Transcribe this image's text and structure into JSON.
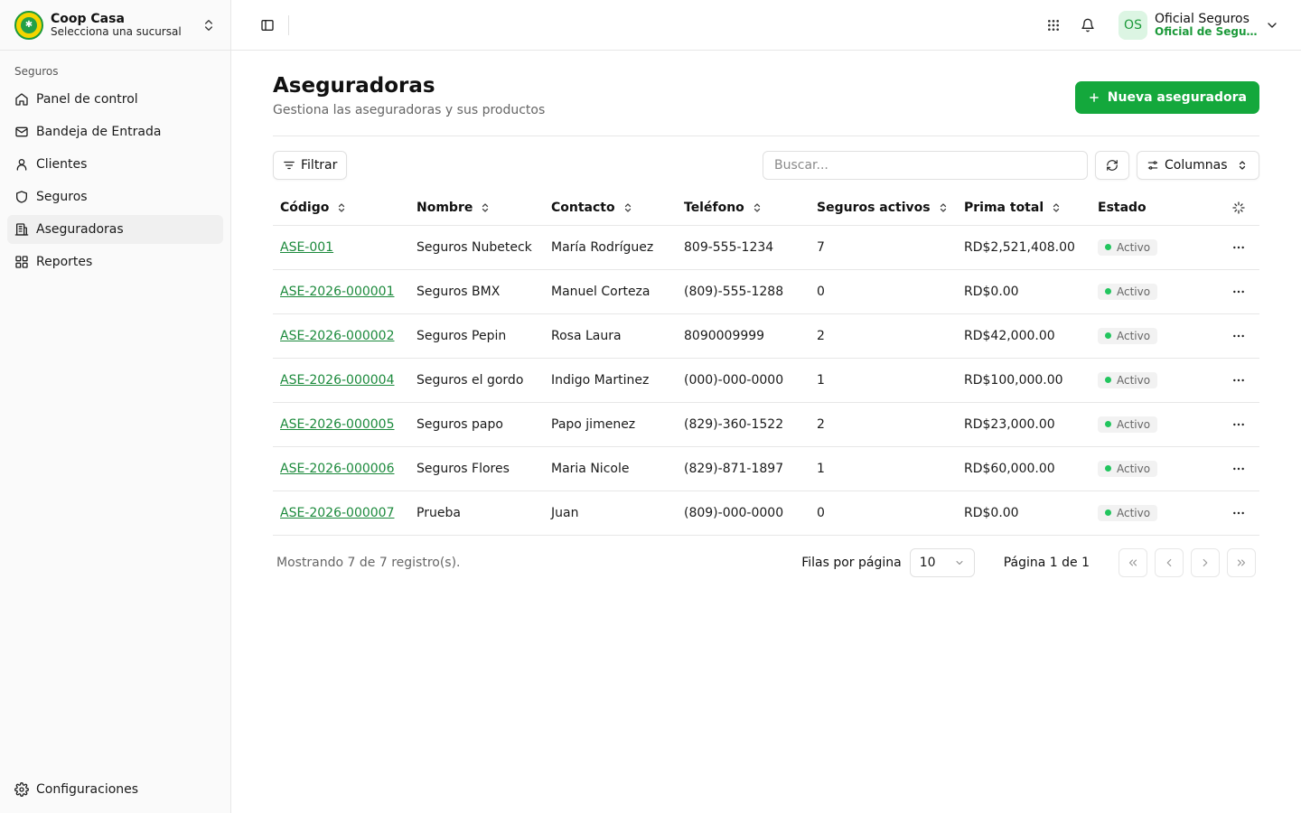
{
  "org": {
    "name": "Coop Casa",
    "subtitle": "Selecciona una sucursal",
    "logo_text": "✱"
  },
  "sidebar": {
    "section_label": "Seguros",
    "items": [
      {
        "label": "Panel de control",
        "icon": "home-icon"
      },
      {
        "label": "Bandeja de Entrada",
        "icon": "mail-icon"
      },
      {
        "label": "Clientes",
        "icon": "user-icon"
      },
      {
        "label": "Seguros",
        "icon": "shield-icon"
      },
      {
        "label": "Aseguradoras",
        "icon": "building-icon",
        "active": true
      },
      {
        "label": "Reportes",
        "icon": "grid-icon"
      }
    ],
    "settings_label": "Configuraciones"
  },
  "user": {
    "initials": "OS",
    "name": "Oficial Seguros",
    "role": "Oficial de Seguros"
  },
  "page": {
    "title": "Aseguradoras",
    "subtitle": "Gestiona las aseguradoras y sus productos",
    "new_button": "Nueva aseguradora"
  },
  "toolbar": {
    "filter_label": "Filtrar",
    "search_placeholder": "Buscar...",
    "columns_label": "Columnas"
  },
  "table": {
    "headers": [
      "Código",
      "Nombre",
      "Contacto",
      "Teléfono",
      "Seguros activos",
      "Prima total",
      "Estado"
    ],
    "rows": [
      {
        "code": "ASE-001",
        "name": "Seguros Nubeteck",
        "contact": "María Rodríguez",
        "phone": "809-555-1234",
        "active": "7",
        "premium": "RD$2,521,408.00",
        "status": "Activo"
      },
      {
        "code": "ASE-2026-000001",
        "name": "Seguros BMX",
        "contact": "Manuel Corteza",
        "phone": "(809)-555-1288",
        "active": "0",
        "premium": "RD$0.00",
        "status": "Activo"
      },
      {
        "code": "ASE-2026-000002",
        "name": "Seguros Pepin",
        "contact": "Rosa Laura",
        "phone": "8090009999",
        "active": "2",
        "premium": "RD$42,000.00",
        "status": "Activo"
      },
      {
        "code": "ASE-2026-000004",
        "name": "Seguros el gordo",
        "contact": "Indigo Martinez",
        "phone": "(000)-000-0000",
        "active": "1",
        "premium": "RD$100,000.00",
        "status": "Activo"
      },
      {
        "code": "ASE-2026-000005",
        "name": "Seguros papo",
        "contact": "Papo jimenez",
        "phone": "(829)-360-1522",
        "active": "2",
        "premium": "RD$23,000.00",
        "status": "Activo"
      },
      {
        "code": "ASE-2026-000006",
        "name": "Seguros Flores",
        "contact": "Maria Nicole",
        "phone": "(829)-871-1897",
        "active": "1",
        "premium": "RD$60,000.00",
        "status": "Activo"
      },
      {
        "code": "ASE-2026-000007",
        "name": "Prueba",
        "contact": "Juan",
        "phone": "(809)-000-0000",
        "active": "0",
        "premium": "RD$0.00",
        "status": "Activo"
      }
    ]
  },
  "footer": {
    "count_text": "Mostrando 7 de 7 registro(s).",
    "rows_per_page_label": "Filas por página",
    "rows_per_page_value": "10",
    "page_text": "Página 1 de 1"
  },
  "colors": {
    "accent": "#14a83c",
    "link": "#1c8a3c",
    "status_dot": "#22c55e"
  }
}
